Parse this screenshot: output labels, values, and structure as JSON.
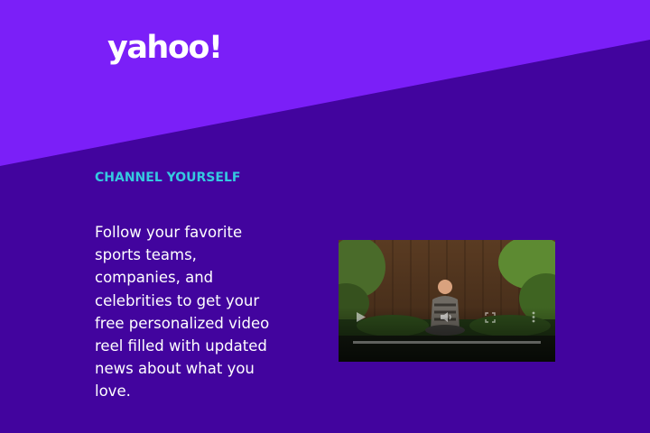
{
  "brand": {
    "logo_text": "yahoo!",
    "bg_color": "#42049e",
    "band_color": "#7b1ff8",
    "accent_color": "#35c9e0"
  },
  "promo": {
    "eyebrow": "CHANNEL YOURSELF",
    "body": "Follow your favorite sports teams, companies, and celebrities to get your free personalized video reel filled with updated news about what you love."
  },
  "video": {
    "icons": [
      "play-icon",
      "volume-icon",
      "fullscreen-icon",
      "more-options-icon"
    ],
    "progress": 0
  }
}
